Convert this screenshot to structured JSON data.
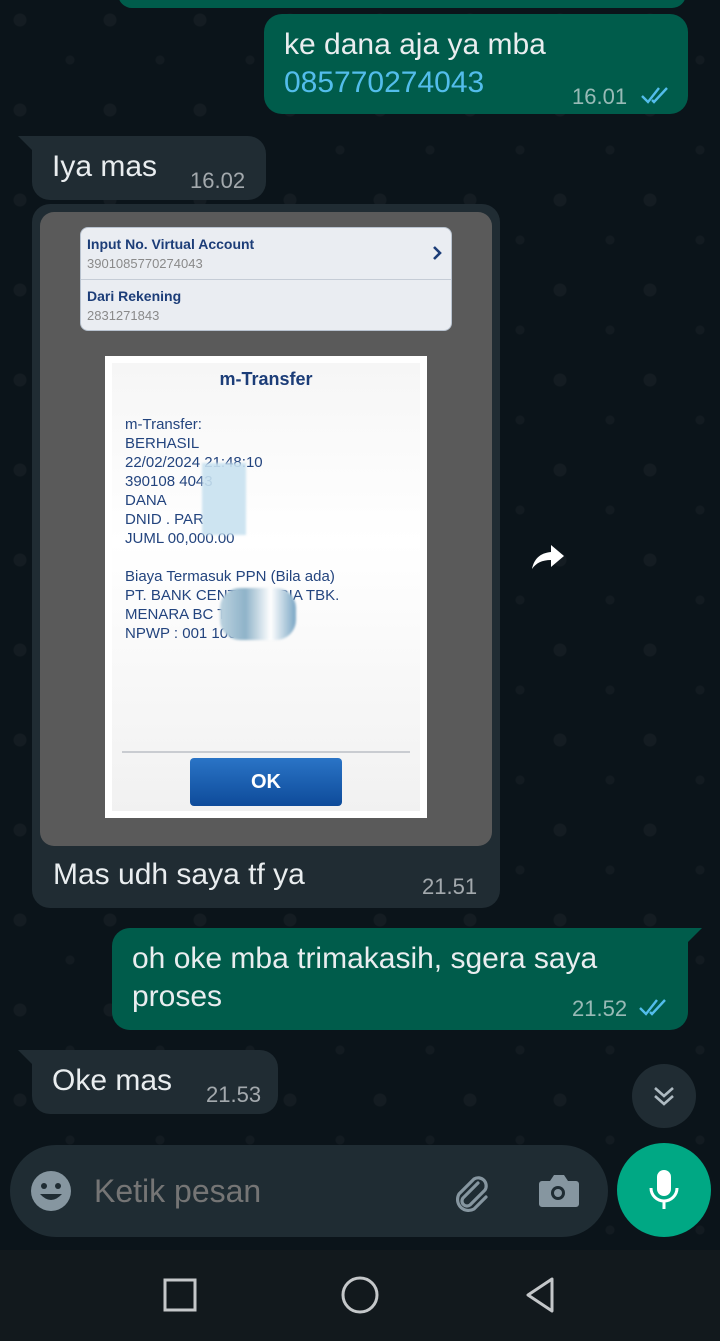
{
  "messages": {
    "m1": {
      "text": "ke dana aja ya mba",
      "link": "085770274043",
      "time": "16.01"
    },
    "m2": {
      "text": "Iya mas",
      "time": "16.02"
    },
    "m3": {
      "caption": "Mas udh saya tf ya",
      "time": "21.51",
      "screenshot": {
        "va_label": "Input No. Virtual Account",
        "va_value": "3901085770274043",
        "rek_label": "Dari Rekening",
        "rek_value": "2831271843",
        "dialog_title": "m-Transfer",
        "lines": [
          "m-Transfer:",
          "BERHASIL",
          "22/02/2024 21:48:10",
          "390108          4043",
          "DANA",
          "DNID                 . PAR",
          "JUML               00,000.00",
          "",
          "Biaya Termasuk PPN (Bila ada)",
          "PT. BANK CENTRAL ASIA TBK.",
          "MENARA BC          TA PUSAT",
          "NPWP : 001              1000"
        ],
        "ok_label": "OK"
      }
    },
    "m4": {
      "line1": "oh oke mba trimakasih, sgera saya",
      "line2": "proses",
      "time": "21.52"
    },
    "m5": {
      "text": "Oke mas",
      "time": "21.53"
    }
  },
  "composer": {
    "placeholder": "Ketik pesan"
  },
  "colors": {
    "outgoing": "#005c4b",
    "incoming": "#202c33",
    "accent": "#00a884",
    "link": "#53bdeb",
    "read_ticks": "#53bdeb"
  },
  "icons": [
    "double-check-icon",
    "forward-icon",
    "chevron-down-icon",
    "emoji-icon",
    "attach-icon",
    "camera-icon",
    "mic-icon",
    "recent-apps-icon",
    "home-icon",
    "back-icon"
  ]
}
